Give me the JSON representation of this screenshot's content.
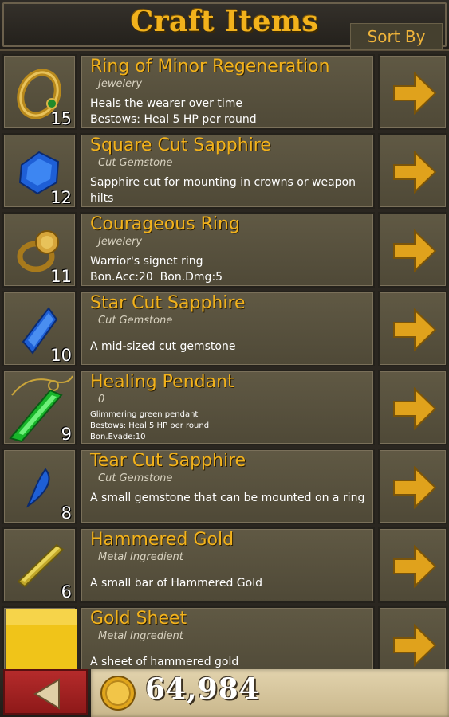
{
  "header": {
    "title": "Craft Items",
    "sort_label": "Sort By"
  },
  "items": [
    {
      "name": "Ring of Minor Regeneration",
      "type": "Jewelery",
      "qty": "15",
      "icon": "gold-ring-icon",
      "desc": "Heals the wearer over time\nBestows: Heal 5 HP per round"
    },
    {
      "name": "Square Cut Sapphire",
      "type": "Cut Gemstone",
      "qty": "12",
      "icon": "square-sapphire-icon",
      "desc": "Sapphire cut for mounting in crowns or weapon hilts"
    },
    {
      "name": "Courageous Ring",
      "type": "Jewelery",
      "qty": "11",
      "icon": "signet-ring-icon",
      "desc": "Warrior's signet ring\nBon.Acc:20  Bon.Dmg:5"
    },
    {
      "name": "Star Cut Sapphire",
      "type": "Cut Gemstone",
      "qty": "10",
      "icon": "star-sapphire-icon",
      "desc": "A mid-sized cut gemstone"
    },
    {
      "name": "Healing Pendant",
      "type": "0",
      "qty": "9",
      "icon": "green-pendant-icon",
      "desc": "Glimmering green pendant\nBestows: Heal 5 HP per round\nBon.Evade:10"
    },
    {
      "name": "Tear Cut Sapphire",
      "type": "Cut Gemstone",
      "qty": "8",
      "icon": "tear-sapphire-icon",
      "desc": "A small gemstone that can be mounted on a ring"
    },
    {
      "name": "Hammered Gold",
      "type": "Metal Ingredient",
      "qty": "6",
      "icon": "gold-bar-icon",
      "desc": "A small bar of Hammered Gold"
    },
    {
      "name": "Gold Sheet",
      "type": "Metal Ingredient",
      "qty": "",
      "icon": "gold-sheet-icon",
      "desc": "A sheet of hammered gold"
    }
  ],
  "footer": {
    "gold_amount": "64,984"
  },
  "colors": {
    "title": "#f2b21c",
    "item_name": "#f2b21c",
    "arrow": "#e0a21c",
    "back_button": "#b52b2b"
  }
}
